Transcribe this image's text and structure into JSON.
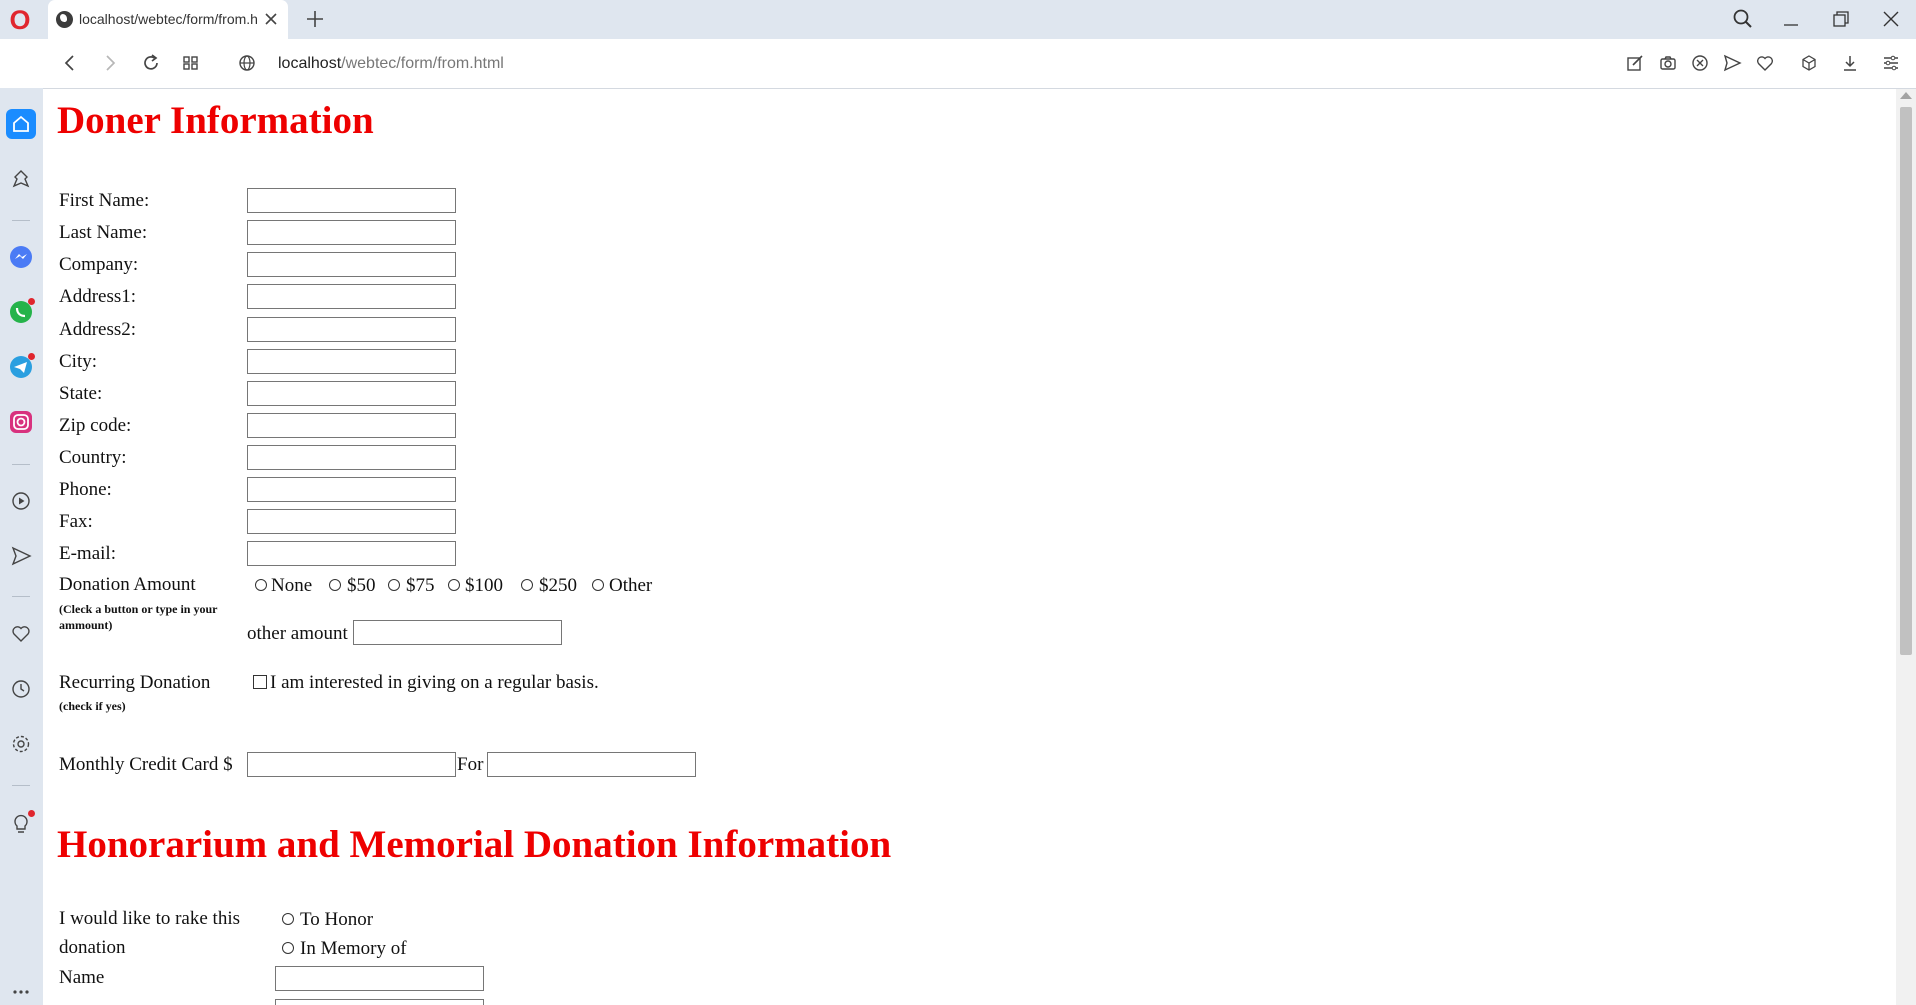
{
  "browser": {
    "tab_title": "localhost/webtec/form/from.html",
    "url_host": "localhost",
    "url_path": "/webtec/form/from.html"
  },
  "donor": {
    "heading": "Doner Information",
    "fields": [
      {
        "label": "First Name:",
        "value": ""
      },
      {
        "label": "Last Name:",
        "value": ""
      },
      {
        "label": "Company:",
        "value": ""
      },
      {
        "label": "Address1:",
        "value": ""
      },
      {
        "label": "Address2:",
        "value": ""
      },
      {
        "label": "City:",
        "value": ""
      },
      {
        "label": "State:",
        "value": ""
      },
      {
        "label": "Zip code:",
        "value": ""
      },
      {
        "label": "Country:",
        "value": ""
      },
      {
        "label": "Phone:",
        "value": ""
      },
      {
        "label": "Fax:",
        "value": ""
      },
      {
        "label": "E-mail:",
        "value": ""
      }
    ],
    "donation_amount": {
      "label": "Donation Amount",
      "hint": "(Cleck a button or type in your ammount)",
      "options": [
        "None",
        "$50",
        "$75",
        "$100",
        "$250",
        "Other"
      ],
      "other_label": "other amount",
      "other_value": ""
    },
    "recurring": {
      "label": "Recurring Donation",
      "hint": "(check if yes)",
      "checkbox_label": "I am interested in giving on a regular basis.",
      "checked": false
    },
    "monthly": {
      "label": "Monthly Credit Card $",
      "for_label": "For",
      "amount_value": "",
      "for_value": ""
    }
  },
  "honorarium": {
    "heading": "Honorarium and Memorial Donation Information",
    "prompt_line1": "I would like to rake this",
    "prompt_line2": "donation",
    "options": [
      "To Honor",
      "In Memory of"
    ],
    "name_label": "Name",
    "name_value": ""
  },
  "colors": {
    "heading": "#ee0000",
    "chrome": "#dfe6ef",
    "accent": "#1a8cff"
  }
}
